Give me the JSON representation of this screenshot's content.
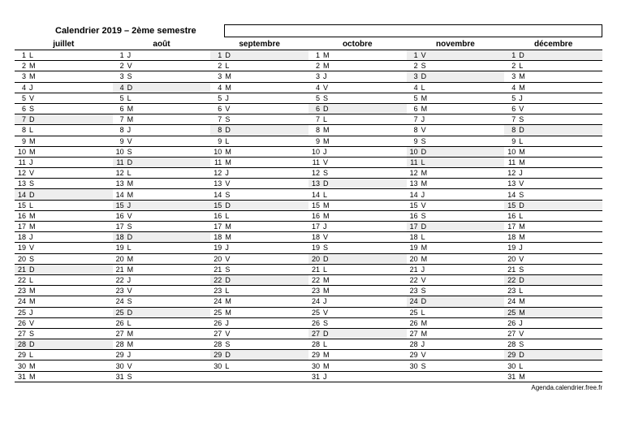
{
  "title": "Calendrier 2019 – 2ème semestre",
  "source": "Agenda.calendrier.free.fr",
  "months": [
    {
      "name": "juillet",
      "days": [
        {
          "n": 1,
          "d": "L"
        },
        {
          "n": 2,
          "d": "M"
        },
        {
          "n": 3,
          "d": "M"
        },
        {
          "n": 4,
          "d": "J"
        },
        {
          "n": 5,
          "d": "V"
        },
        {
          "n": 6,
          "d": "S"
        },
        {
          "n": 7,
          "d": "D",
          "sh": true
        },
        {
          "n": 8,
          "d": "L"
        },
        {
          "n": 9,
          "d": "M"
        },
        {
          "n": 10,
          "d": "M"
        },
        {
          "n": 11,
          "d": "J"
        },
        {
          "n": 12,
          "d": "V"
        },
        {
          "n": 13,
          "d": "S"
        },
        {
          "n": 14,
          "d": "D",
          "sh": true
        },
        {
          "n": 15,
          "d": "L"
        },
        {
          "n": 16,
          "d": "M"
        },
        {
          "n": 17,
          "d": "M"
        },
        {
          "n": 18,
          "d": "J"
        },
        {
          "n": 19,
          "d": "V"
        },
        {
          "n": 20,
          "d": "S"
        },
        {
          "n": 21,
          "d": "D",
          "sh": true
        },
        {
          "n": 22,
          "d": "L"
        },
        {
          "n": 23,
          "d": "M"
        },
        {
          "n": 24,
          "d": "M"
        },
        {
          "n": 25,
          "d": "J"
        },
        {
          "n": 26,
          "d": "V"
        },
        {
          "n": 27,
          "d": "S"
        },
        {
          "n": 28,
          "d": "D",
          "sh": true
        },
        {
          "n": 29,
          "d": "L"
        },
        {
          "n": 30,
          "d": "M"
        },
        {
          "n": 31,
          "d": "M"
        }
      ]
    },
    {
      "name": "août",
      "days": [
        {
          "n": 1,
          "d": "J"
        },
        {
          "n": 2,
          "d": "V"
        },
        {
          "n": 3,
          "d": "S"
        },
        {
          "n": 4,
          "d": "D",
          "sh": true
        },
        {
          "n": 5,
          "d": "L"
        },
        {
          "n": 6,
          "d": "M"
        },
        {
          "n": 7,
          "d": "M"
        },
        {
          "n": 8,
          "d": "J"
        },
        {
          "n": 9,
          "d": "V"
        },
        {
          "n": 10,
          "d": "S"
        },
        {
          "n": 11,
          "d": "D",
          "sh": true
        },
        {
          "n": 12,
          "d": "L"
        },
        {
          "n": 13,
          "d": "M"
        },
        {
          "n": 14,
          "d": "M"
        },
        {
          "n": 15,
          "d": "J",
          "sh": true
        },
        {
          "n": 16,
          "d": "V"
        },
        {
          "n": 17,
          "d": "S"
        },
        {
          "n": 18,
          "d": "D",
          "sh": true
        },
        {
          "n": 19,
          "d": "L"
        },
        {
          "n": 20,
          "d": "M"
        },
        {
          "n": 21,
          "d": "M"
        },
        {
          "n": 22,
          "d": "J"
        },
        {
          "n": 23,
          "d": "V"
        },
        {
          "n": 24,
          "d": "S"
        },
        {
          "n": 25,
          "d": "D",
          "sh": true
        },
        {
          "n": 26,
          "d": "L"
        },
        {
          "n": 27,
          "d": "M"
        },
        {
          "n": 28,
          "d": "M"
        },
        {
          "n": 29,
          "d": "J"
        },
        {
          "n": 30,
          "d": "V"
        },
        {
          "n": 31,
          "d": "S"
        }
      ]
    },
    {
      "name": "septembre",
      "days": [
        {
          "n": 1,
          "d": "D",
          "sh": true
        },
        {
          "n": 2,
          "d": "L"
        },
        {
          "n": 3,
          "d": "M"
        },
        {
          "n": 4,
          "d": "M"
        },
        {
          "n": 5,
          "d": "J"
        },
        {
          "n": 6,
          "d": "V"
        },
        {
          "n": 7,
          "d": "S"
        },
        {
          "n": 8,
          "d": "D",
          "sh": true
        },
        {
          "n": 9,
          "d": "L"
        },
        {
          "n": 10,
          "d": "M"
        },
        {
          "n": 11,
          "d": "M"
        },
        {
          "n": 12,
          "d": "J"
        },
        {
          "n": 13,
          "d": "V"
        },
        {
          "n": 14,
          "d": "S"
        },
        {
          "n": 15,
          "d": "D",
          "sh": true
        },
        {
          "n": 16,
          "d": "L"
        },
        {
          "n": 17,
          "d": "M"
        },
        {
          "n": 18,
          "d": "M"
        },
        {
          "n": 19,
          "d": "J"
        },
        {
          "n": 20,
          "d": "V"
        },
        {
          "n": 21,
          "d": "S"
        },
        {
          "n": 22,
          "d": "D",
          "sh": true
        },
        {
          "n": 23,
          "d": "L"
        },
        {
          "n": 24,
          "d": "M"
        },
        {
          "n": 25,
          "d": "M"
        },
        {
          "n": 26,
          "d": "J"
        },
        {
          "n": 27,
          "d": "V"
        },
        {
          "n": 28,
          "d": "S"
        },
        {
          "n": 29,
          "d": "D",
          "sh": true
        },
        {
          "n": 30,
          "d": "L"
        }
      ]
    },
    {
      "name": "octobre",
      "days": [
        {
          "n": 1,
          "d": "M"
        },
        {
          "n": 2,
          "d": "M"
        },
        {
          "n": 3,
          "d": "J"
        },
        {
          "n": 4,
          "d": "V"
        },
        {
          "n": 5,
          "d": "S"
        },
        {
          "n": 6,
          "d": "D",
          "sh": true
        },
        {
          "n": 7,
          "d": "L"
        },
        {
          "n": 8,
          "d": "M"
        },
        {
          "n": 9,
          "d": "M"
        },
        {
          "n": 10,
          "d": "J"
        },
        {
          "n": 11,
          "d": "V"
        },
        {
          "n": 12,
          "d": "S"
        },
        {
          "n": 13,
          "d": "D",
          "sh": true
        },
        {
          "n": 14,
          "d": "L"
        },
        {
          "n": 15,
          "d": "M"
        },
        {
          "n": 16,
          "d": "M"
        },
        {
          "n": 17,
          "d": "J"
        },
        {
          "n": 18,
          "d": "V"
        },
        {
          "n": 19,
          "d": "S"
        },
        {
          "n": 20,
          "d": "D",
          "sh": true
        },
        {
          "n": 21,
          "d": "L"
        },
        {
          "n": 22,
          "d": "M"
        },
        {
          "n": 23,
          "d": "M"
        },
        {
          "n": 24,
          "d": "J"
        },
        {
          "n": 25,
          "d": "V"
        },
        {
          "n": 26,
          "d": "S"
        },
        {
          "n": 27,
          "d": "D",
          "sh": true
        },
        {
          "n": 28,
          "d": "L"
        },
        {
          "n": 29,
          "d": "M"
        },
        {
          "n": 30,
          "d": "M"
        },
        {
          "n": 31,
          "d": "J"
        }
      ]
    },
    {
      "name": "novembre",
      "days": [
        {
          "n": 1,
          "d": "V",
          "sh": true
        },
        {
          "n": 2,
          "d": "S"
        },
        {
          "n": 3,
          "d": "D",
          "sh": true
        },
        {
          "n": 4,
          "d": "L"
        },
        {
          "n": 5,
          "d": "M"
        },
        {
          "n": 6,
          "d": "M"
        },
        {
          "n": 7,
          "d": "J"
        },
        {
          "n": 8,
          "d": "V"
        },
        {
          "n": 9,
          "d": "S"
        },
        {
          "n": 10,
          "d": "D",
          "sh": true
        },
        {
          "n": 11,
          "d": "L",
          "sh": true
        },
        {
          "n": 12,
          "d": "M"
        },
        {
          "n": 13,
          "d": "M"
        },
        {
          "n": 14,
          "d": "J"
        },
        {
          "n": 15,
          "d": "V"
        },
        {
          "n": 16,
          "d": "S"
        },
        {
          "n": 17,
          "d": "D",
          "sh": true
        },
        {
          "n": 18,
          "d": "L"
        },
        {
          "n": 19,
          "d": "M"
        },
        {
          "n": 20,
          "d": "M"
        },
        {
          "n": 21,
          "d": "J"
        },
        {
          "n": 22,
          "d": "V"
        },
        {
          "n": 23,
          "d": "S"
        },
        {
          "n": 24,
          "d": "D",
          "sh": true
        },
        {
          "n": 25,
          "d": "L"
        },
        {
          "n": 26,
          "d": "M"
        },
        {
          "n": 27,
          "d": "M"
        },
        {
          "n": 28,
          "d": "J"
        },
        {
          "n": 29,
          "d": "V"
        },
        {
          "n": 30,
          "d": "S"
        }
      ]
    },
    {
      "name": "décembre",
      "days": [
        {
          "n": 1,
          "d": "D",
          "sh": true
        },
        {
          "n": 2,
          "d": "L"
        },
        {
          "n": 3,
          "d": "M"
        },
        {
          "n": 4,
          "d": "M"
        },
        {
          "n": 5,
          "d": "J"
        },
        {
          "n": 6,
          "d": "V"
        },
        {
          "n": 7,
          "d": "S"
        },
        {
          "n": 8,
          "d": "D",
          "sh": true
        },
        {
          "n": 9,
          "d": "L"
        },
        {
          "n": 10,
          "d": "M"
        },
        {
          "n": 11,
          "d": "M"
        },
        {
          "n": 12,
          "d": "J"
        },
        {
          "n": 13,
          "d": "V"
        },
        {
          "n": 14,
          "d": "S"
        },
        {
          "n": 15,
          "d": "D",
          "sh": true
        },
        {
          "n": 16,
          "d": "L"
        },
        {
          "n": 17,
          "d": "M"
        },
        {
          "n": 18,
          "d": "M"
        },
        {
          "n": 19,
          "d": "J"
        },
        {
          "n": 20,
          "d": "V"
        },
        {
          "n": 21,
          "d": "S"
        },
        {
          "n": 22,
          "d": "D",
          "sh": true
        },
        {
          "n": 23,
          "d": "L"
        },
        {
          "n": 24,
          "d": "M"
        },
        {
          "n": 25,
          "d": "M",
          "sh": true
        },
        {
          "n": 26,
          "d": "J"
        },
        {
          "n": 27,
          "d": "V"
        },
        {
          "n": 28,
          "d": "S"
        },
        {
          "n": 29,
          "d": "D",
          "sh": true
        },
        {
          "n": 30,
          "d": "L"
        },
        {
          "n": 31,
          "d": "M"
        }
      ]
    }
  ]
}
